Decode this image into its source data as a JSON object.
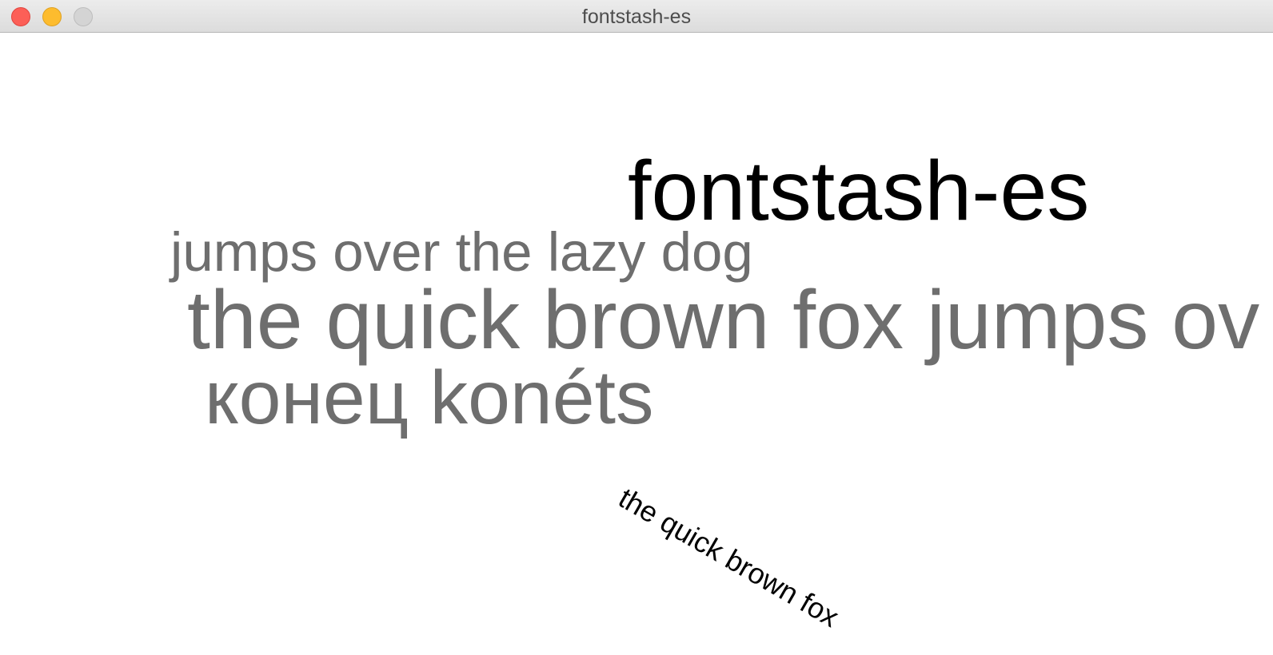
{
  "window": {
    "title": "fontstash-es",
    "controls": {
      "close": "close-button",
      "minimize": "minimize-button",
      "zoom": "zoom-button"
    }
  },
  "canvas": {
    "heading": "fontstash-es",
    "line_1": "jumps over the lazy dog",
    "line_2": "the quick brown fox jumps ov",
    "line_3": "конец konéts",
    "rotated_text": "the quick brown fox"
  },
  "colors": {
    "heading": "#000000",
    "gray_text": "#6e6e6e",
    "rotated_text": "#000000",
    "close": "#fc5f57",
    "minimize": "#fdbc2e",
    "zoom": "#d4d4d4"
  }
}
